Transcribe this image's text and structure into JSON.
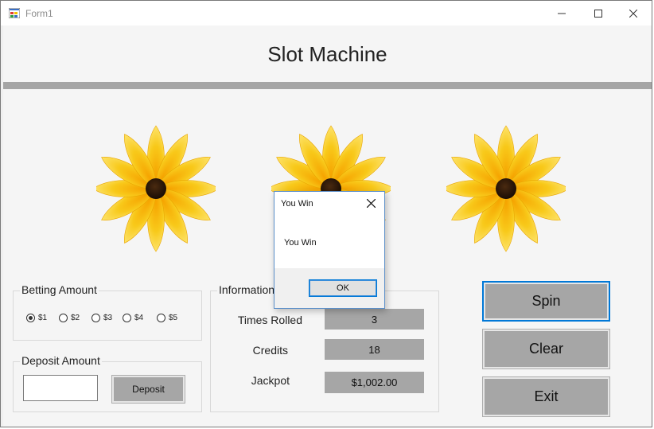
{
  "window": {
    "title": "Form1"
  },
  "header": {
    "title": "Slot Machine"
  },
  "reels": [
    {
      "icon": "sunflower-icon"
    },
    {
      "icon": "sunflower-icon"
    },
    {
      "icon": "sunflower-icon"
    }
  ],
  "betting": {
    "label": "Betting Amount",
    "options": [
      "$1",
      "$2",
      "$3",
      "$4",
      "$5"
    ],
    "selected": "$1"
  },
  "deposit": {
    "label": "Deposit Amount",
    "input_value": "",
    "button_label": "Deposit"
  },
  "information": {
    "label": "Information",
    "times_rolled_label": "Times Rolled",
    "times_rolled": "3",
    "credits_label": "Credits",
    "credits": "18",
    "jackpot_label": "Jackpot",
    "jackpot": "$1,002.00"
  },
  "actions": {
    "spin": "Spin",
    "clear": "Clear",
    "exit": "Exit"
  },
  "dialog": {
    "title": "You Win",
    "message": "You Win",
    "ok_label": "OK"
  },
  "colors": {
    "panel": "#f5f5f5",
    "button_gray": "#a6a6a6",
    "accent_blue": "#0078d7",
    "flower_yellow": "#f7c817"
  }
}
